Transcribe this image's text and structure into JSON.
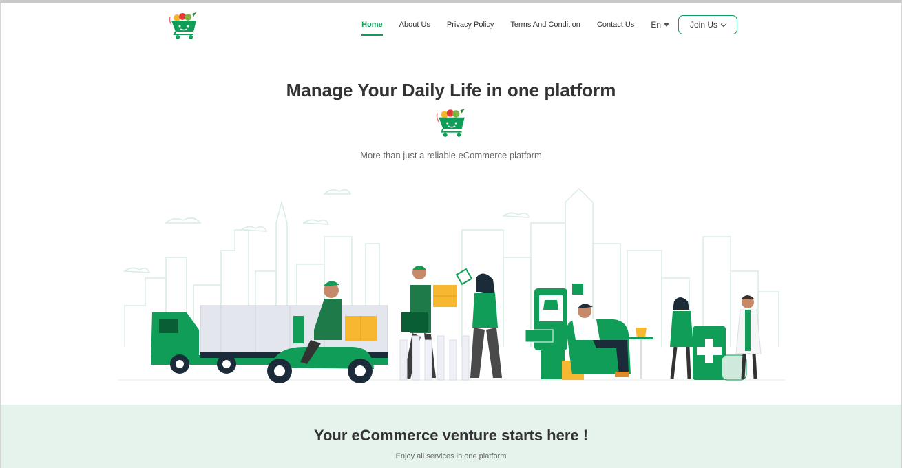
{
  "nav": {
    "links": [
      {
        "label": "Home",
        "active": true
      },
      {
        "label": "About Us"
      },
      {
        "label": "Privacy Policy"
      },
      {
        "label": "Terms And Condition"
      },
      {
        "label": "Contact Us"
      }
    ],
    "language": "En",
    "join_label": "Join Us"
  },
  "hero": {
    "title": "Manage Your Daily Life in one platform",
    "subtitle": "More than just a reliable eCommerce platform"
  },
  "band": {
    "title": "Your eCommerce venture starts here !",
    "subtitle": "Enjoy all services in one platform"
  },
  "colors": {
    "brand_green": "#0f9d58",
    "band_bg": "#e5f3ec",
    "accent_yellow": "#f7b731"
  },
  "icons": {
    "logo": "shopping-cart-logo-icon",
    "language_caret": "caret-down-icon",
    "join_chevron": "chevron-down-icon"
  }
}
